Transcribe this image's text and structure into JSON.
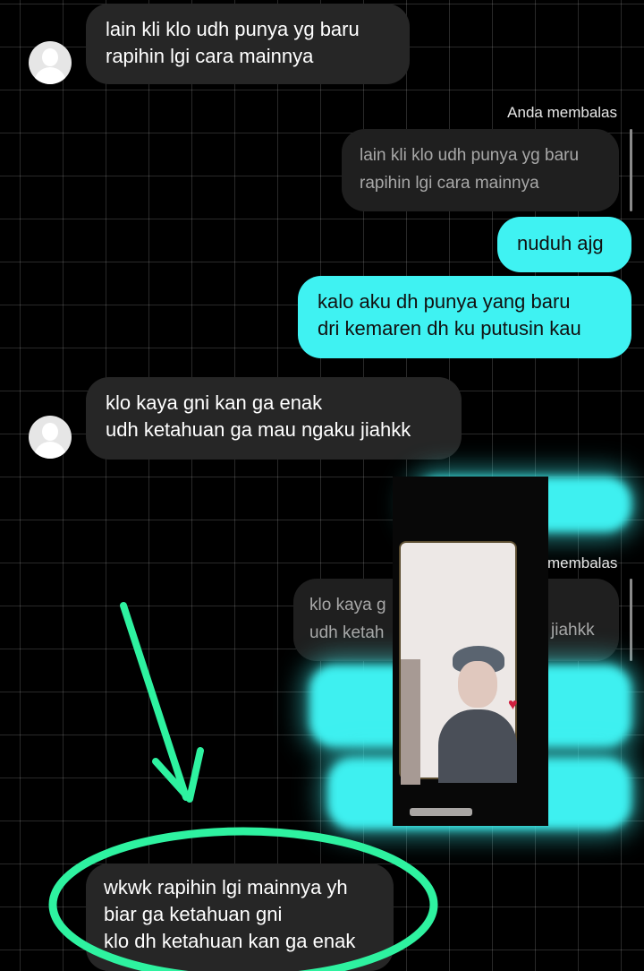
{
  "messages": {
    "m1": {
      "lines": [
        "lain kli klo udh punya yg baru",
        "rapihin lgi cara mainnya"
      ]
    },
    "reply_label_1": "Anda membalas",
    "quote1": {
      "lines": [
        "lain kli klo udh punya yg baru",
        "rapihin lgi cara mainnya"
      ]
    },
    "m2": {
      "lines": [
        "nuduh ajg"
      ]
    },
    "m3": {
      "lines": [
        "kalo aku dh punya yang baru",
        "dri kemaren dh ku putusin kau"
      ]
    },
    "m4": {
      "lines": [
        "klo kaya gni kan ga enak",
        "udh ketahuan ga mau ngaku jiahkk"
      ]
    },
    "reply_label_2_partial": "membalas",
    "quote2_partial": {
      "left_lines": [
        "klo kaya g",
        "udh ketah"
      ],
      "right_line2": "jiahkk"
    },
    "m5": {
      "lines": [
        "wkwk rapihin lgi mainnya yh",
        "biar ga ketahuan gni",
        "klo dh ketahuan kan ga enak"
      ]
    }
  },
  "colors": {
    "outgoing": "#3ff2f2",
    "incoming": "#262626",
    "annotation": "#2ef2a0"
  },
  "icons": {
    "avatar": "default-user-avatar",
    "arrow": "hand-drawn-arrow",
    "circle": "hand-drawn-ellipse"
  }
}
